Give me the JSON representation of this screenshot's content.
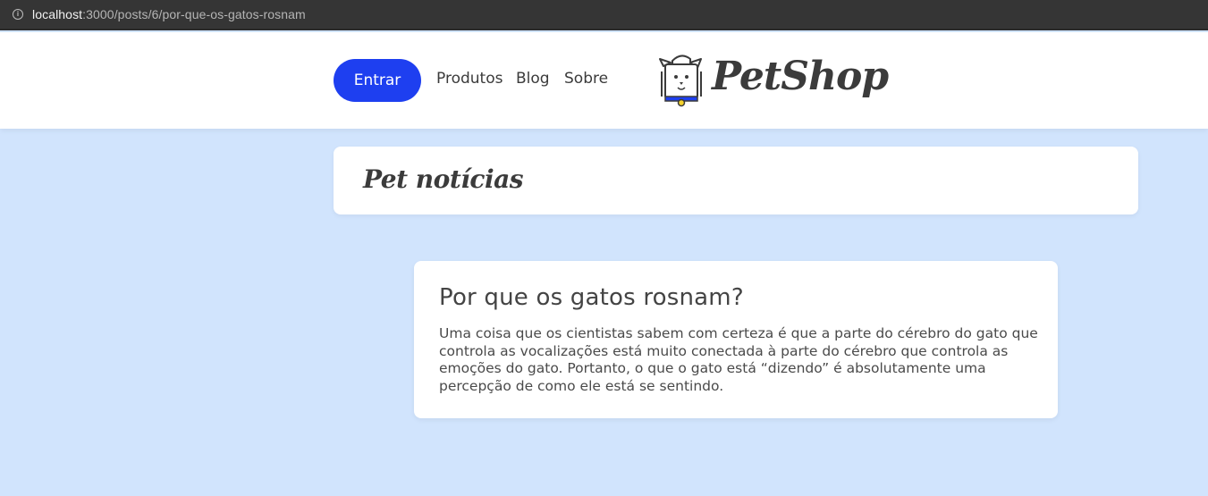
{
  "browser": {
    "url_host": "localhost",
    "url_path": ":3000/posts/6/por-que-os-gatos-rosnam"
  },
  "header": {
    "login_button": "Entrar",
    "nav": [
      "Produtos",
      "Blog",
      "Sobre"
    ],
    "logo_text": "PetShop"
  },
  "page": {
    "title": "Pet notícias"
  },
  "post": {
    "title": "Por que os gatos rosnam?",
    "body": "Uma coisa que os cientistas sabem com certeza é que a parte do cérebro do gato que controla as vocalizações está muito conectada à parte do cérebro que controla as emoções do gato. Portanto, o que o gato está “dizendo” é absolutamente uma percepção de como ele está se sentindo."
  },
  "colors": {
    "background": "#d1e4fd",
    "accent": "#1e3ff0",
    "text": "#3b3b3b"
  }
}
